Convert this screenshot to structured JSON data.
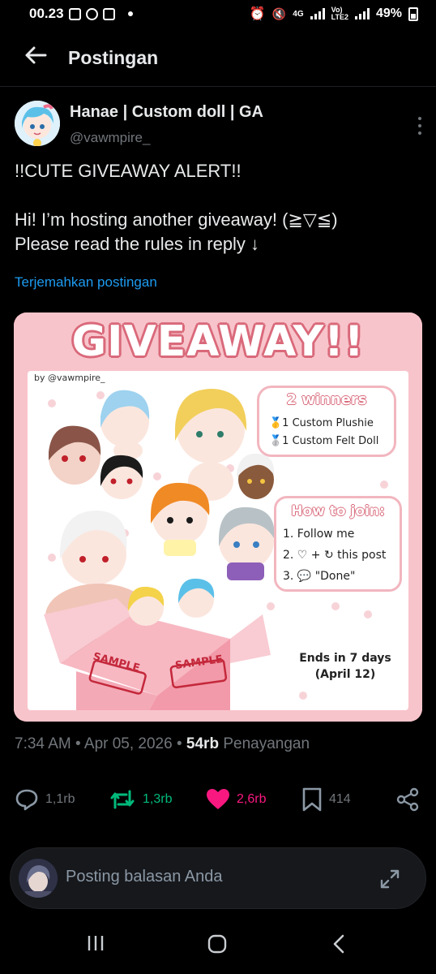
{
  "status_bar": {
    "time": "00.23",
    "network": "4G",
    "lte_label": "Vo)\nLTE2",
    "battery": "49%"
  },
  "header": {
    "title": "Postingan"
  },
  "post": {
    "author": {
      "display_name": "Hanae | Custom doll | GA",
      "handle": "@vawmpire_"
    },
    "text_line1": "!!CUTE GIVEAWAY ALERT!!",
    "text_line2": "Hi! I’m hosting another giveaway! (≧▽≦)",
    "text_line3": "Please read the rules in reply ↓",
    "translate_label": "Terjemahkan postingan",
    "image": {
      "title": "GIVEAWAY!!",
      "by_line": "by @vawmpire_",
      "winners_title": "2 winners",
      "prize_1": "🥇1 Custom Plushie",
      "prize_2": "🥈1 Custom Felt Doll",
      "join_title": "How to join:",
      "step_1": "1. Follow me",
      "step_2": "2. ♡ + ↻ this post",
      "step_3": "3. 💬 \"Done\"",
      "ends_1": "Ends in 7 days",
      "ends_2": "(April 12)",
      "sample_1": "SAMPLE",
      "sample_2": "SAMPLE"
    },
    "meta": {
      "time": "7:34 AM",
      "date": "Apr 05, 2026",
      "views_count": "54rb",
      "views_label": "Penayangan"
    },
    "actions": {
      "replies": "1,1rb",
      "reposts": "1,3rb",
      "likes": "2,6rb",
      "bookmarks": "414"
    }
  },
  "reply_bar": {
    "placeholder": "Posting balasan Anda"
  },
  "colors": {
    "accent_blue": "#1d9bf0",
    "repost_green": "#00ba7c",
    "like_pink": "#f91880",
    "muted": "#71767b"
  }
}
